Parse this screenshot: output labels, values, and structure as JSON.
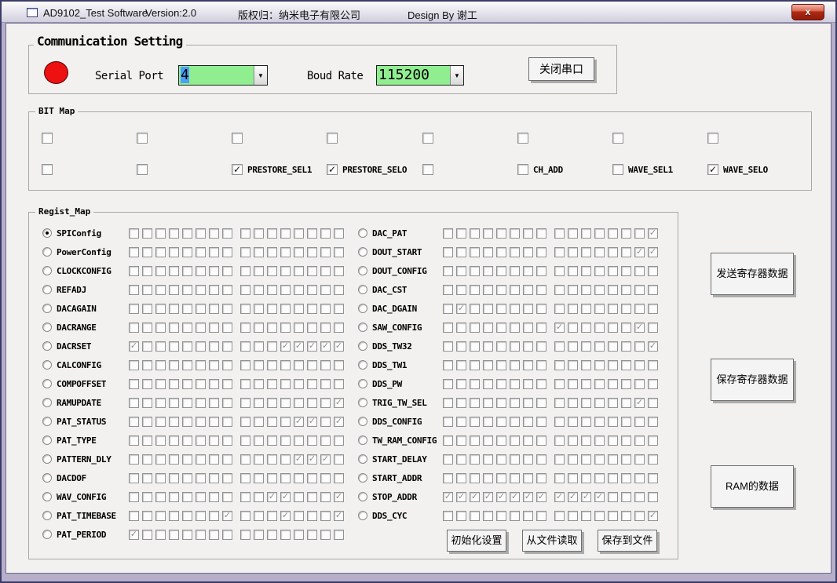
{
  "window": {
    "title": "AD9102_Test Software",
    "version": "Version:2.0",
    "copyright": "版权归：纳米电子有限公司",
    "designer": "Design By 谢工",
    "close_glyph": "x"
  },
  "colors": {
    "status_indicator_red": "#ee1111",
    "combo_green": "#90ee90",
    "selection_blue": "#4c9ffb",
    "frame_lavender": "#b7afc9",
    "client_gray": "#f2f1ef"
  },
  "communication": {
    "group_title": "Communication Setting",
    "serial_port_label": "Serial Port",
    "serial_port_value": "4",
    "baud_rate_label": "Boud Rate",
    "baud_rate_value": "115200",
    "close_port_button": "关闭串口"
  },
  "bit_map": {
    "group_title": "BIT Map",
    "rows": [
      [
        {
          "label": "",
          "checked": false
        },
        {
          "label": "",
          "checked": false
        },
        {
          "label": "",
          "checked": false
        },
        {
          "label": "",
          "checked": false
        },
        {
          "label": "",
          "checked": false
        },
        {
          "label": "",
          "checked": false
        },
        {
          "label": "",
          "checked": false
        },
        {
          "label": "",
          "checked": false
        }
      ],
      [
        {
          "label": "",
          "checked": false
        },
        {
          "label": "",
          "checked": false
        },
        {
          "label": "PRESTORE_SEL1",
          "checked": true
        },
        {
          "label": "PRESTORE_SELO",
          "checked": true
        },
        {
          "label": "",
          "checked": false
        },
        {
          "label": "CH_ADD",
          "checked": false
        },
        {
          "label": "WAVE_SEL1",
          "checked": false
        },
        {
          "label": "WAVE_SELO",
          "checked": true
        }
      ]
    ]
  },
  "regist_map": {
    "group_title": "Regist_Map",
    "left_rows": [
      {
        "label": "SPIConfig",
        "selected": true,
        "bits": [
          0,
          0,
          0,
          0,
          0,
          0,
          0,
          0,
          0,
          0,
          0,
          0,
          0,
          0,
          0,
          0
        ]
      },
      {
        "label": "PowerConfig",
        "selected": false,
        "bits": [
          0,
          0,
          0,
          0,
          0,
          0,
          0,
          0,
          0,
          0,
          0,
          0,
          0,
          0,
          0,
          0
        ]
      },
      {
        "label": "CLOCKCONFIG",
        "selected": false,
        "bits": [
          0,
          0,
          0,
          0,
          0,
          0,
          0,
          0,
          0,
          0,
          0,
          0,
          0,
          0,
          0,
          0
        ]
      },
      {
        "label": "REFADJ",
        "selected": false,
        "bits": [
          0,
          0,
          0,
          0,
          0,
          0,
          0,
          0,
          0,
          0,
          0,
          0,
          0,
          0,
          0,
          0
        ]
      },
      {
        "label": "DACAGAIN",
        "selected": false,
        "bits": [
          0,
          0,
          0,
          0,
          0,
          0,
          0,
          0,
          0,
          0,
          0,
          0,
          0,
          0,
          0,
          0
        ]
      },
      {
        "label": "DACRANGE",
        "selected": false,
        "bits": [
          0,
          0,
          0,
          0,
          0,
          0,
          0,
          0,
          0,
          0,
          0,
          0,
          0,
          0,
          0,
          0
        ]
      },
      {
        "label": "DACRSET",
        "selected": false,
        "bits": [
          1,
          0,
          0,
          0,
          0,
          0,
          0,
          0,
          0,
          0,
          0,
          1,
          1,
          1,
          1,
          1
        ]
      },
      {
        "label": "CALCONFIG",
        "selected": false,
        "bits": [
          0,
          0,
          0,
          0,
          0,
          0,
          0,
          0,
          0,
          0,
          0,
          0,
          0,
          0,
          0,
          0
        ]
      },
      {
        "label": "COMPOFFSET",
        "selected": false,
        "bits": [
          0,
          0,
          0,
          0,
          0,
          0,
          0,
          0,
          0,
          0,
          0,
          0,
          0,
          0,
          0,
          0
        ]
      },
      {
        "label": "RAMUPDATE",
        "selected": false,
        "bits": [
          0,
          0,
          0,
          0,
          0,
          0,
          0,
          0,
          0,
          0,
          0,
          0,
          0,
          0,
          0,
          1
        ]
      },
      {
        "label": "PAT_STATUS",
        "selected": false,
        "bits": [
          0,
          0,
          0,
          0,
          0,
          0,
          0,
          0,
          0,
          0,
          0,
          0,
          1,
          1,
          0,
          1
        ]
      },
      {
        "label": "PAT_TYPE",
        "selected": false,
        "bits": [
          0,
          0,
          0,
          0,
          0,
          0,
          0,
          0,
          0,
          0,
          0,
          0,
          0,
          0,
          0,
          0
        ]
      },
      {
        "label": "PATTERN_DLY",
        "selected": false,
        "bits": [
          0,
          0,
          0,
          0,
          0,
          0,
          0,
          0,
          0,
          0,
          0,
          0,
          1,
          1,
          1,
          0
        ]
      },
      {
        "label": "DACDOF",
        "selected": false,
        "bits": [
          0,
          0,
          0,
          0,
          0,
          0,
          0,
          0,
          0,
          0,
          0,
          0,
          0,
          0,
          0,
          0
        ]
      },
      {
        "label": "WAV_CONFIG",
        "selected": false,
        "bits": [
          0,
          0,
          0,
          0,
          0,
          0,
          0,
          0,
          0,
          0,
          1,
          1,
          0,
          0,
          0,
          1
        ]
      },
      {
        "label": "PAT_TIMEBASE",
        "selected": false,
        "bits": [
          0,
          0,
          0,
          0,
          0,
          0,
          0,
          1,
          0,
          0,
          0,
          1,
          0,
          0,
          0,
          1
        ]
      },
      {
        "label": "PAT_PERIOD",
        "selected": false,
        "bits": [
          1,
          0,
          0,
          0,
          0,
          0,
          0,
          0,
          0,
          0,
          0,
          0,
          0,
          0,
          0,
          0
        ]
      }
    ],
    "right_rows": [
      {
        "label": "DAC_PAT",
        "selected": false,
        "bits": [
          0,
          0,
          0,
          0,
          0,
          0,
          0,
          0,
          0,
          0,
          0,
          0,
          0,
          0,
          0,
          1
        ]
      },
      {
        "label": "DOUT_START",
        "selected": false,
        "bits": [
          0,
          0,
          0,
          0,
          0,
          0,
          0,
          0,
          0,
          0,
          0,
          0,
          0,
          0,
          1,
          1
        ]
      },
      {
        "label": "DOUT_CONFIG",
        "selected": false,
        "bits": [
          0,
          0,
          0,
          0,
          0,
          0,
          0,
          0,
          0,
          0,
          0,
          0,
          0,
          0,
          0,
          0
        ]
      },
      {
        "label": "DAC_CST",
        "selected": false,
        "bits": [
          0,
          0,
          0,
          0,
          0,
          0,
          0,
          0,
          0,
          0,
          0,
          0,
          0,
          0,
          0,
          0
        ]
      },
      {
        "label": "DAC_DGAIN",
        "selected": false,
        "bits": [
          0,
          1,
          0,
          0,
          0,
          0,
          0,
          0,
          0,
          0,
          0,
          0,
          0,
          0,
          0,
          0
        ]
      },
      {
        "label": "SAW_CONFIG",
        "selected": false,
        "bits": [
          0,
          0,
          0,
          0,
          0,
          0,
          0,
          0,
          1,
          0,
          0,
          0,
          0,
          0,
          1,
          0
        ]
      },
      {
        "label": "DDS_TW32",
        "selected": false,
        "bits": [
          0,
          0,
          0,
          0,
          0,
          0,
          0,
          0,
          0,
          0,
          0,
          0,
          0,
          0,
          0,
          1
        ]
      },
      {
        "label": "DDS_TW1",
        "selected": false,
        "bits": [
          0,
          0,
          0,
          0,
          0,
          0,
          0,
          0,
          0,
          0,
          0,
          0,
          0,
          0,
          0,
          0
        ]
      },
      {
        "label": "DDS_PW",
        "selected": false,
        "bits": [
          0,
          0,
          0,
          0,
          0,
          0,
          0,
          0,
          0,
          0,
          0,
          0,
          0,
          0,
          0,
          0
        ]
      },
      {
        "label": "TRIG_TW_SEL",
        "selected": false,
        "bits": [
          0,
          0,
          0,
          0,
          0,
          0,
          0,
          0,
          0,
          0,
          0,
          0,
          0,
          0,
          1,
          0
        ]
      },
      {
        "label": "DDS_CONFIG",
        "selected": false,
        "bits": [
          0,
          0,
          0,
          0,
          0,
          0,
          0,
          0,
          0,
          0,
          0,
          0,
          0,
          0,
          0,
          0
        ]
      },
      {
        "label": "TW_RAM_CONFIG",
        "selected": false,
        "bits": [
          0,
          0,
          0,
          0,
          0,
          0,
          0,
          0,
          0,
          0,
          0,
          0,
          0,
          0,
          0,
          0
        ]
      },
      {
        "label": "START_DELAY",
        "selected": false,
        "bits": [
          0,
          0,
          0,
          0,
          0,
          0,
          0,
          0,
          0,
          0,
          0,
          0,
          0,
          0,
          0,
          0
        ]
      },
      {
        "label": "START_ADDR",
        "selected": false,
        "bits": [
          0,
          0,
          0,
          0,
          0,
          0,
          0,
          0,
          0,
          0,
          0,
          0,
          0,
          0,
          0,
          0
        ]
      },
      {
        "label": "STOP_ADDR",
        "selected": false,
        "bits": [
          1,
          1,
          1,
          1,
          1,
          1,
          1,
          1,
          1,
          1,
          1,
          1,
          0,
          0,
          0,
          0
        ]
      },
      {
        "label": "DDS_CYC",
        "selected": false,
        "bits": [
          0,
          0,
          0,
          0,
          0,
          0,
          0,
          0,
          0,
          0,
          0,
          0,
          0,
          0,
          0,
          1
        ]
      }
    ],
    "bottom_buttons": [
      "初始化设置",
      "从文件读取",
      "保存到文件"
    ]
  },
  "side_buttons": [
    "发送寄存器数据",
    "保存寄存器数据",
    "RAM的数据"
  ]
}
